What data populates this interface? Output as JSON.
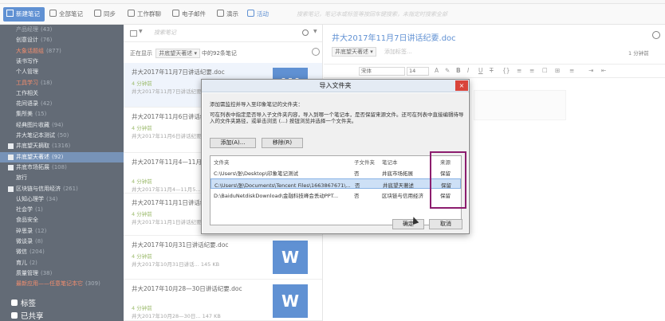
{
  "toolbar": {
    "new_note": "新建笔记",
    "all_notes": "全部笔记",
    "sync": "同步",
    "work_chat": "工作群聊",
    "email": "电子邮件",
    "present": "演示",
    "activity": "活动",
    "search_hint": "搜索笔记，笔记本或标签等按回车键搜索，未指定时搜索全部"
  },
  "sidebar": {
    "items": [
      {
        "label": "产品经理",
        "count": "(43)",
        "style": "grey"
      },
      {
        "label": "创意设计",
        "count": "(76)",
        "style": "normal"
      },
      {
        "label": "大象话题组",
        "count": "(877)",
        "style": "red"
      },
      {
        "label": "读书写作",
        "count": "",
        "style": "normal"
      },
      {
        "label": "个人管理",
        "count": "",
        "style": "normal"
      },
      {
        "label": "工具学习",
        "count": "(18)",
        "style": "red"
      },
      {
        "label": "工作相关",
        "count": "",
        "style": "normal"
      },
      {
        "label": "花间语录",
        "count": "(42)",
        "style": "normal"
      },
      {
        "label": "集所美",
        "count": "(15)",
        "style": "normal"
      },
      {
        "label": "经典图片收藏",
        "count": "(94)",
        "style": "normal"
      },
      {
        "label": "井大笔记本测试",
        "count": "(50)",
        "style": "normal"
      },
      {
        "label": "井底望天摘取",
        "count": "(1316)",
        "style": "book"
      },
      {
        "label": "井底望天著述",
        "count": "(92)",
        "style": "book-sel"
      },
      {
        "label": "井底市场拓展",
        "count": "(108)",
        "style": "book"
      },
      {
        "label": "旅行",
        "count": "",
        "style": "normal"
      },
      {
        "label": "区块链与信用经济",
        "count": "(261)",
        "style": "book"
      },
      {
        "label": "认知心理学",
        "count": "(34)",
        "style": "normal"
      },
      {
        "label": "社会学",
        "count": "(1)",
        "style": "normal"
      },
      {
        "label": "食品安全",
        "count": "",
        "style": "normal"
      },
      {
        "label": "碎思录",
        "count": "(12)",
        "style": "normal"
      },
      {
        "label": "微谈录",
        "count": "(8)",
        "style": "normal"
      },
      {
        "label": "微信",
        "count": "(204)",
        "style": "normal"
      },
      {
        "label": "育儿",
        "count": "(2)",
        "style": "normal"
      },
      {
        "label": "质量管理",
        "count": "(38)",
        "style": "normal"
      },
      {
        "label": "最新应用——任意笔记本它",
        "count": "(309)",
        "style": "red"
      }
    ],
    "tags_label": "标签",
    "shared_label": "已共享"
  },
  "list": {
    "search_placeholder": "搜索笔记",
    "showing_prefix": "正在显示",
    "notebook": "井底望天著述",
    "showing_suffix": "中的92条笔记",
    "notes": [
      {
        "title": "井大2017年11月7日讲话纪要.doc",
        "time": "4 分钟前",
        "preview": "井大2017年11月7日讲话纪要...",
        "thumb": "W"
      },
      {
        "title": "井大2017年11月6日讲话纪要.doc",
        "time": "4 分钟前",
        "preview": "井大2017年11月6日讲话纪要...",
        "thumb": "W"
      },
      {
        "title": "井大2017年11月4—11月5日讲话纪要.doc",
        "time": "4 分钟前",
        "preview": "井大2017年11月4—11月5...",
        "thumb": "W"
      },
      {
        "title": "井大2017年11月1日讲话纪要.doc",
        "time": "4 分钟前",
        "preview": "井大2017年11月1日讲话纪要...",
        "thumb": "W"
      },
      {
        "title": "井大2017年10月31日讲话纪要.doc",
        "time": "4 分钟前",
        "preview": "井大2017年10月31日讲话...  145 KB",
        "thumb": "W"
      },
      {
        "title": "井大2017年10月28—30日讲话纪要.doc",
        "time": "4 分钟前",
        "preview": "井大2017年10月28—30日...  147 KB",
        "thumb": "W"
      }
    ]
  },
  "editor": {
    "title": "井大2017年11月7日讲话纪要.doc",
    "notebook": "井底望天著述",
    "add_tag": "添加标签...",
    "words": "1 分钟前",
    "font": "宋体",
    "size": "14"
  },
  "dialog": {
    "title": "导入文件夹",
    "close": "×",
    "intro": "添加需监控并导入至印象笔记的文件夹：",
    "desc": "可在列表中指定是否导入子文件夹内容，导入到哪一个笔记本，是否保留来源文件。还可在列表中直接编辑待导入的文件夹路径，或单击浏览 (...) 按钮浏览并选择一个文件夹。",
    "add_btn": "添加(A)...",
    "remove_btn": "移除(R)",
    "columns": [
      "文件夹",
      "子文件夹",
      "笔记本",
      "来源"
    ],
    "rows": [
      {
        "folder": "C:\\Users\\张\\Desktop\\印象笔记测试",
        "sub": "否",
        "notebook": "井底市场拓展",
        "source": "保留"
      },
      {
        "folder": "C:\\Users\\张\\Documents\\Tencent Files\\1663867671\\...",
        "sub": "否",
        "notebook": "井底望天著述",
        "source": "保留"
      },
      {
        "folder": "D:\\BaiduNetdiskDownload\\金融科技峰会丢动PPT...",
        "sub": "否",
        "notebook": "区块链与信用经济",
        "source": "保留"
      }
    ],
    "ok": "确定",
    "cancel": "取消"
  }
}
